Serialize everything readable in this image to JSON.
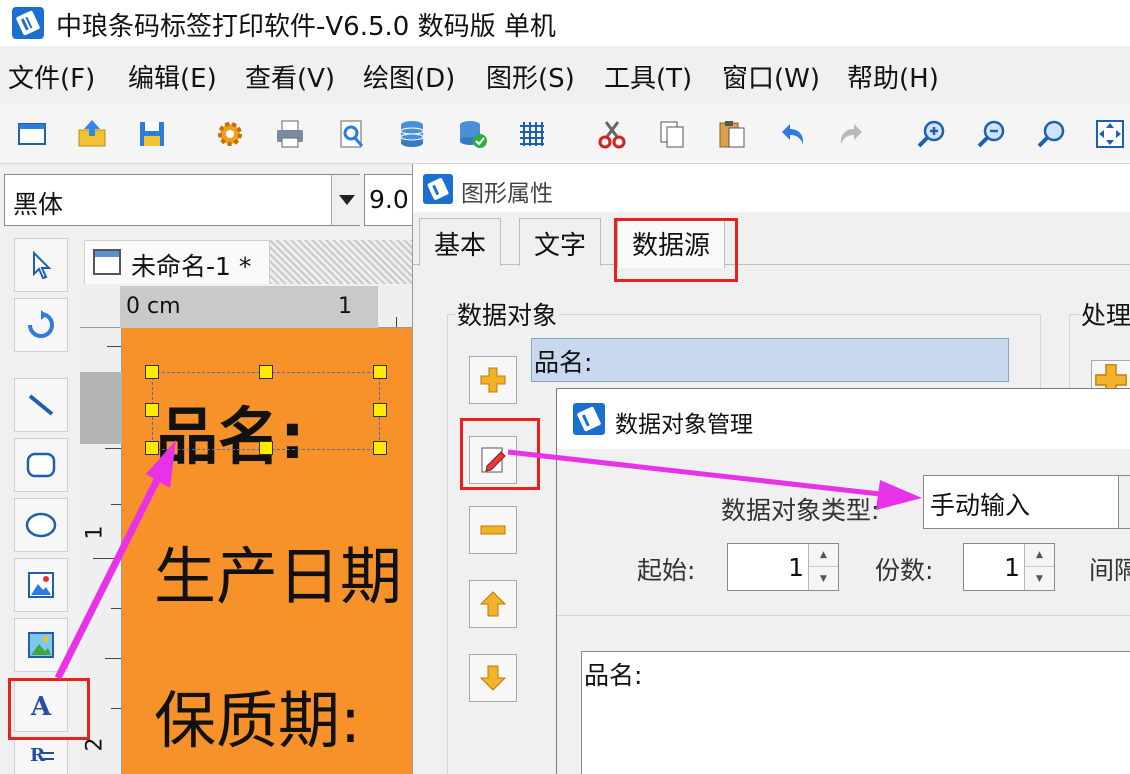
{
  "app": {
    "title": "中琅条码标签打印软件-V6.5.0 数码版 单机"
  },
  "menu": {
    "items": [
      {
        "label": "文件(F)"
      },
      {
        "label": "编辑(E)"
      },
      {
        "label": "查看(V)"
      },
      {
        "label": "绘图(D)"
      },
      {
        "label": "图形(S)"
      },
      {
        "label": "工具(T)"
      },
      {
        "label": "窗口(W)"
      },
      {
        "label": "帮助(H)"
      }
    ]
  },
  "toolbar": {
    "icons": [
      "new-icon",
      "open-icon",
      "save-icon",
      "settings-gear-icon",
      "print-icon",
      "print-preview-icon",
      "database-icon",
      "database-connect-icon",
      "grid-icon",
      "cut-icon",
      "copy-icon",
      "paste-icon",
      "undo-icon",
      "redo-icon",
      "zoom-in-icon",
      "zoom-out-icon",
      "zoom-icon",
      "fit-icon"
    ]
  },
  "font_bar": {
    "font_name": "黑体",
    "font_size": "9.0"
  },
  "document": {
    "tab_label": "未命名-1 *",
    "ruler_unit": "0 cm",
    "ruler_mark_1": "1",
    "ruler_v_1": "1",
    "ruler_v_2": "2",
    "label_lines": [
      "品名:",
      "生产日期",
      "保质期:"
    ]
  },
  "props_dialog": {
    "title": "图形属性",
    "tabs": [
      {
        "label": "基本"
      },
      {
        "label": "文字"
      },
      {
        "label": "数据源"
      }
    ],
    "active_tab": "数据源",
    "group_data_object": "数据对象",
    "group_process": "处理",
    "list_items": [
      "品名:"
    ]
  },
  "mgr_dialog": {
    "title": "数据对象管理",
    "type_label": "数据对象类型:",
    "type_value": "手动输入",
    "start_label": "起始:",
    "start_value": "1",
    "copies_label": "份数:",
    "copies_value": "1",
    "interval_label": "间隔",
    "content": "品名:"
  },
  "colors": {
    "canvas": "#f7912a",
    "highlight": "#e8211d",
    "arrow": "#e832e8",
    "handle": "#ffea00",
    "list_selection": "#c8d8ee"
  }
}
